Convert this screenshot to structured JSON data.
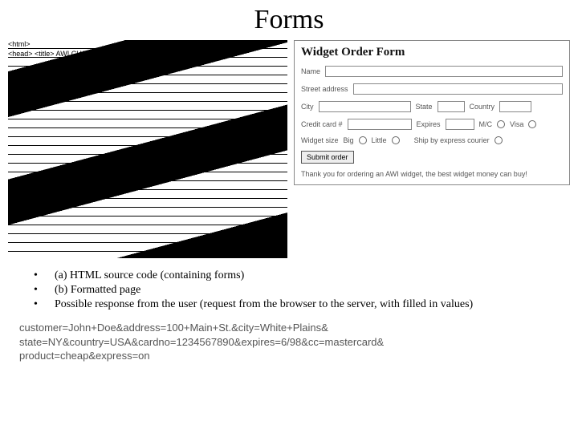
{
  "title": "Forms",
  "source": {
    "line1": "<html>",
    "line2": "<head> <title> AWI CUSTOMER ORDERING FORM </title> </head>"
  },
  "form": {
    "heading": "Widget Order Form",
    "labels": {
      "name": "Name",
      "street": "Street address",
      "city": "City",
      "state": "State",
      "country": "Country",
      "card": "Credit card #",
      "expires": "Expires",
      "mc": "M/C",
      "visa": "Visa",
      "widget_size": "Widget size",
      "big": "Big",
      "little": "Little",
      "ship": "Ship by express courier"
    },
    "submit": "Submit order",
    "thanks": "Thank you for ordering an AWI widget, the best widget money can buy!"
  },
  "bullets": [
    "(a) HTML source code (containing forms)",
    "(b) Formatted page",
    "Possible response from the user (request from the browser to the server, with filled in values)"
  ],
  "response": {
    "l1": "customer=John+Doe&address=100+Main+St.&city=White+Plains&",
    "l2": "state=NY&country=USA&cardno=1234567890&expires=6/98&cc=mastercard&",
    "l3": "product=cheap&express=on"
  }
}
